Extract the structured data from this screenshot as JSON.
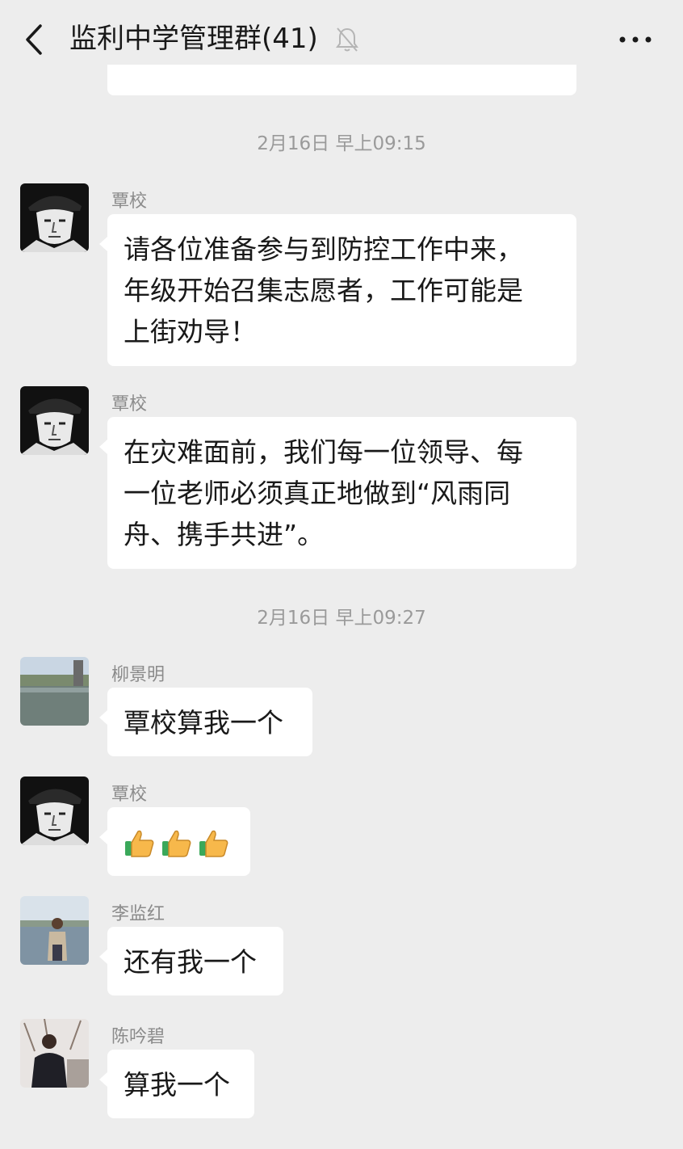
{
  "header": {
    "title": "监利中学管理群(41)"
  },
  "messages": [
    {
      "type": "time",
      "text": "2月16日 早上09:15"
    },
    {
      "type": "msg",
      "sender": "覃校",
      "lines": [
        "请各位准备参与到防控工作中来，",
        "年级开始召集志愿者，工作可能是",
        "上街劝导！"
      ]
    },
    {
      "type": "msg",
      "sender": "覃校",
      "lines": [
        "在灾难面前，我们每一位领导、每",
        "一位老师必须真正地做到“风雨同",
        "舟、携手共进”。"
      ]
    },
    {
      "type": "time",
      "text": "2月16日 早上09:27"
    },
    {
      "type": "msg",
      "sender": "柳景明",
      "lines": [
        "覃校算我一个"
      ]
    },
    {
      "type": "msg",
      "sender": "覃校",
      "emoji": [
        "thumbs-up",
        "thumbs-up",
        "thumbs-up"
      ]
    },
    {
      "type": "msg",
      "sender": "李监红",
      "lines": [
        "还有我一个"
      ]
    },
    {
      "type": "msg",
      "sender": "陈吟碧",
      "lines": [
        "算我一个"
      ]
    }
  ],
  "icons": {
    "back": "chevron-left-icon",
    "mute": "bell-off-icon",
    "more": "more-dots-icon"
  },
  "colors": {
    "background": "#ededed",
    "bubble": "#ffffff",
    "time_text": "#9a9a9a",
    "sender_text": "#8b8b8b"
  }
}
